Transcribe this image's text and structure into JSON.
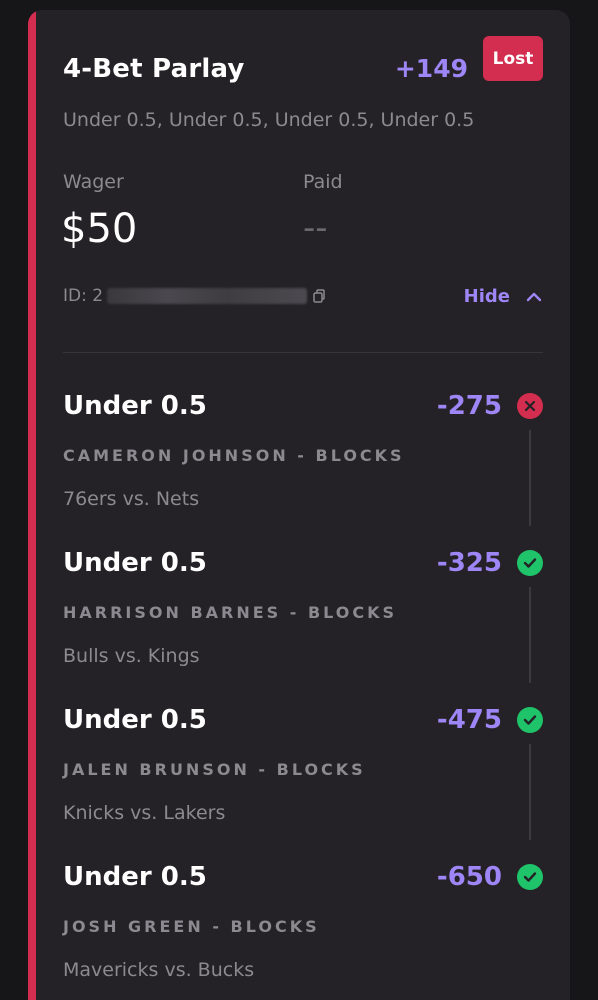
{
  "bet": {
    "title": "4-Bet Parlay",
    "odds": "+149",
    "status": "Lost",
    "legs_summary": "Under 0.5, Under 0.5, Under 0.5, Under 0.5",
    "wager_label": "Wager",
    "wager_value": "$50",
    "paid_label": "Paid",
    "paid_value": "--",
    "id_label": "ID: 2",
    "hide_label": "Hide"
  },
  "legs": [
    {
      "selection": "Under 0.5",
      "odds": "-275",
      "player": "Cameron Johnson - Blocks",
      "game": "76ers vs. Nets",
      "result": "lost",
      "result_icon": "x-circle-icon"
    },
    {
      "selection": "Under 0.5",
      "odds": "-325",
      "player": "Harrison Barnes - Blocks",
      "game": "Bulls vs. Kings",
      "result": "won",
      "result_icon": "check-circle-icon"
    },
    {
      "selection": "Under 0.5",
      "odds": "-475",
      "player": "Jalen Brunson - Blocks",
      "game": "Knicks vs. Lakers",
      "result": "won",
      "result_icon": "check-circle-icon"
    },
    {
      "selection": "Under 0.5",
      "odds": "-650",
      "player": "Josh Green - Blocks",
      "game": "Mavericks vs. Bucks",
      "result": "won",
      "result_icon": "check-circle-icon"
    }
  ],
  "colors": {
    "accent": "#d32d4f",
    "odds": "#9f86f6",
    "won": "#1fc36a",
    "card": "#242226"
  }
}
